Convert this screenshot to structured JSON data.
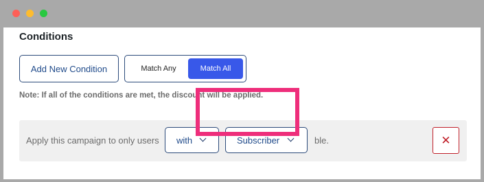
{
  "window": {
    "controls": [
      "close",
      "minimize",
      "maximize"
    ]
  },
  "section": {
    "title": "Conditions"
  },
  "buttons": {
    "add_new_condition": "Add New Condition"
  },
  "match_toggle": {
    "options": [
      "Match Any",
      "Match All"
    ],
    "selected": "Match All"
  },
  "note": "Note: If all of the conditions are met, the discount will be applied.",
  "condition": {
    "prefix_text": "Apply this campaign to only users",
    "operator": "with",
    "value": "Subscriber",
    "suffix_text": "ble.",
    "delete_icon": "close-icon"
  },
  "colors": {
    "accent": "#3858e9",
    "border": "#2b4a7a",
    "danger": "#c0202a",
    "highlight": "#ee2e7b"
  }
}
